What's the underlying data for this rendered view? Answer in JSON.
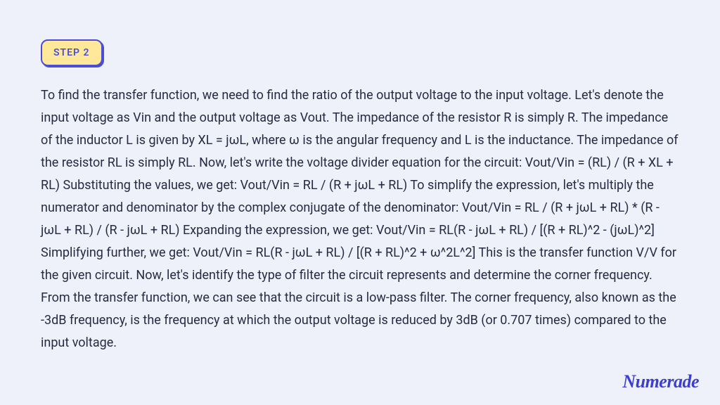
{
  "step": {
    "label": "STEP 2"
  },
  "explanation": {
    "text": "To find the transfer function, we need to find the ratio of the output voltage to the input voltage. Let's denote the input voltage as Vin and the output voltage as Vout. The impedance of the resistor R is simply R. The impedance of the inductor L is given by XL = jωL, where ω is the angular frequency and L is the inductance. The impedance of the resistor RL is simply RL. Now, let's write the voltage divider equation for the circuit: Vout/Vin = (RL) / (R + XL + RL) Substituting the values, we get: Vout/Vin = RL / (R + jωL + RL) To simplify the expression, let's multiply the numerator and denominator by the complex conjugate of the denominator: Vout/Vin = RL / (R + jωL + RL) * (R - jωL + RL) / (R - jωL + RL) Expanding the expression, we get: Vout/Vin = RL(R - jωL + RL) / [(R + RL)^2 - (jωL)^2] Simplifying further, we get: Vout/Vin = RL(R - jωL + RL) / [(R + RL)^2 + ω^2L^2] This is the transfer function V/V for the given circuit. Now, let's identify the type of filter the circuit represents and determine the corner frequency. From the transfer function, we can see that the circuit is a low-pass filter. The corner frequency, also known as the -3dB frequency, is the frequency at which the output voltage is reduced by 3dB (or 0.707 times) compared to the input voltage."
  },
  "brand": {
    "name": "Numerade"
  }
}
